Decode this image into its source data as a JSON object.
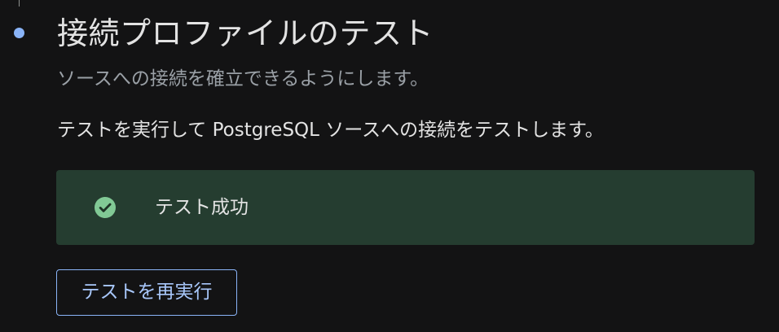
{
  "step": {
    "title": "接続プロファイルのテスト",
    "subtitle": "ソースへの接続を確立できるようにします。",
    "description": "テストを実行して PostgreSQL ソースへの接続をテストします。"
  },
  "result": {
    "status_icon": "check-circle-icon",
    "message": "テスト成功"
  },
  "actions": {
    "retest_label": "テストを再実行"
  },
  "colors": {
    "background": "#131314",
    "step_dot": "#8ab4f8",
    "success_banner": "#253d30",
    "success_icon": "#81c995",
    "button_text": "#a8c7fa"
  }
}
